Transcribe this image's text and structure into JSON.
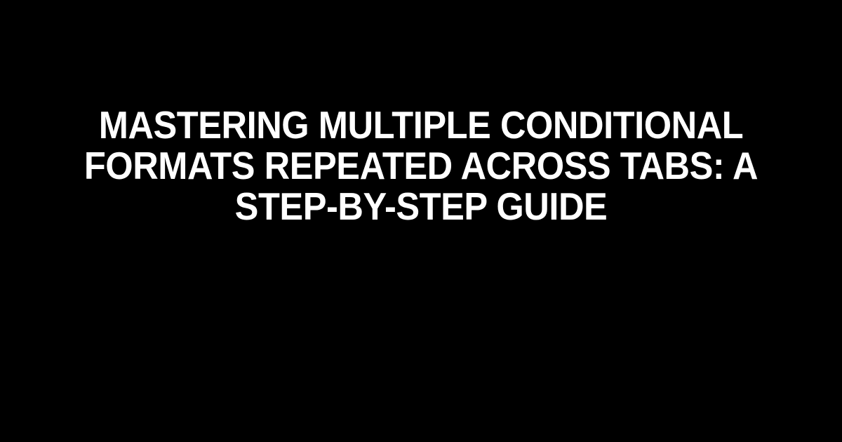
{
  "title": "MASTERING MULTIPLE CONDITIONAL FORMATS REPEATED ACROSS TABS: A STEP-BY-STEP GUIDE"
}
